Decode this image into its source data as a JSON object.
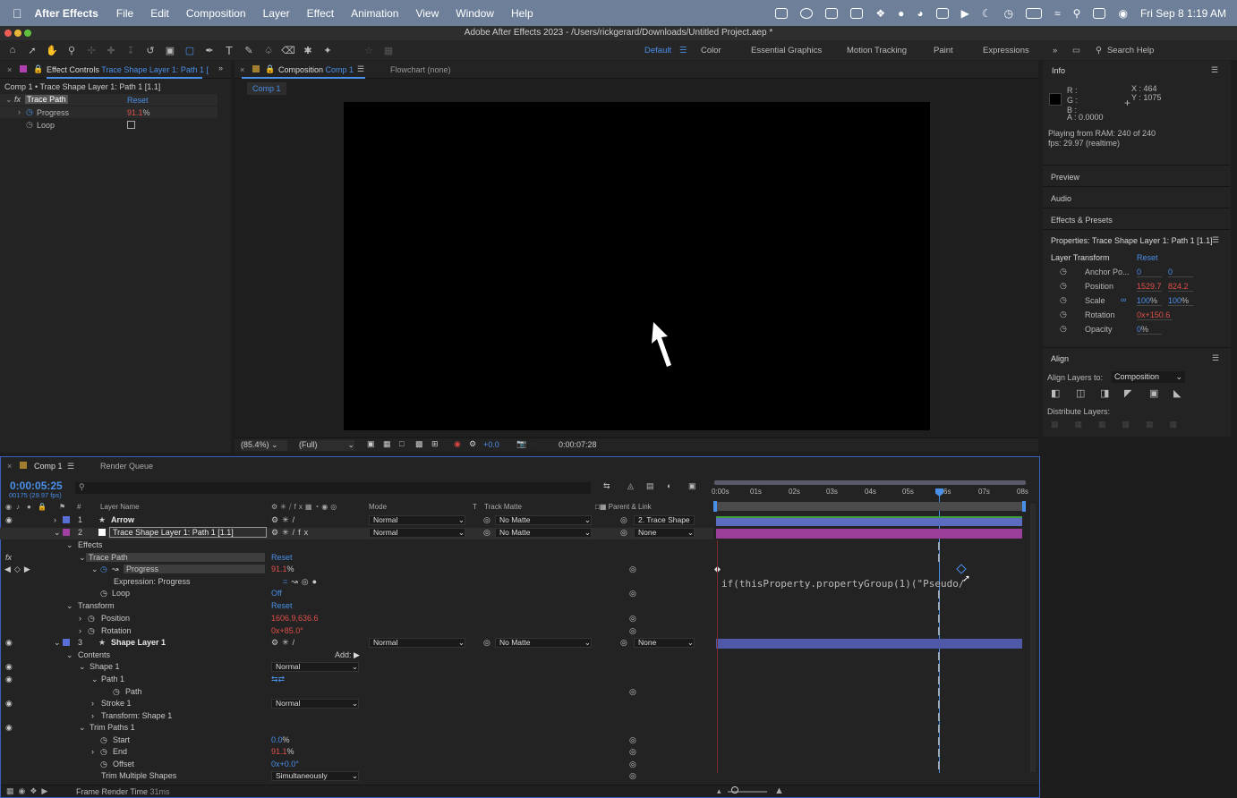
{
  "menubar": {
    "app": "After Effects",
    "items": [
      "File",
      "Edit",
      "Composition",
      "Layer",
      "Effect",
      "Animation",
      "View",
      "Window",
      "Help"
    ],
    "clock": "Fri Sep 8  1:19 AM"
  },
  "window": {
    "title": "Adobe After Effects 2023 - /Users/rickgerard/Downloads/Untitled Project.aep *"
  },
  "workspaces": {
    "active": "Default",
    "items": [
      "Color",
      "Essential Graphics",
      "Motion Tracking",
      "Paint",
      "Expressions"
    ],
    "search_placeholder": "Search Help"
  },
  "effect_controls": {
    "tab_label": "Effect Controls",
    "tab_layer": "Trace Shape Layer 1: Path 1 [",
    "breadcrumb": "Comp 1 • Trace Shape Layer 1: Path 1 [1.1]",
    "fx_name": "Trace Path",
    "reset": "Reset",
    "progress_label": "Progress",
    "progress_value": "91.1",
    "percent": "%",
    "loop_label": "Loop"
  },
  "composition": {
    "tab_label": "Composition",
    "tab_comp": "Comp 1",
    "flowchart": "Flowchart (none)",
    "subtab": "Comp 1",
    "zoom": "(85.4%)",
    "resolution": "(Full)",
    "exposure": "+0.0",
    "timecode": "0:00:07:28"
  },
  "info": {
    "title": "Info",
    "r": "R :",
    "g": "G :",
    "b": "B :",
    "a": "A :  0.0000",
    "x": "X : 464",
    "y": "Y : 1075",
    "playing": "Playing from RAM: 240 of 240",
    "fps": "fps: 29.97 (realtime)"
  },
  "sections": {
    "preview": "Preview",
    "audio": "Audio",
    "effects_presets": "Effects & Presets"
  },
  "properties": {
    "title": "Properties: Trace Shape Layer 1: Path 1 [1.1]",
    "group": "Layer Transform",
    "reset": "Reset",
    "anchor_label": "Anchor Po...",
    "anchor_x": "0",
    "anchor_y": "0",
    "position_label": "Position",
    "position_x": "1529.7",
    "position_y": "824.2",
    "scale_label": "Scale",
    "scale_x": "100",
    "scale_y": "100",
    "rotation_label": "Rotation",
    "rotation_value": "0x+150.6",
    "opacity_label": "Opacity",
    "opacity_value": "0"
  },
  "align": {
    "title": "Align",
    "align_to_label": "Align Layers to:",
    "align_to_value": "Composition",
    "distribute_label": "Distribute Layers:"
  },
  "timeline": {
    "tab": "Comp 1",
    "render_queue": "Render Queue",
    "timecode": "0:00:05:25",
    "frames": "00175 (29.97 fps)",
    "col_layer_name": "Layer Name",
    "col_mode": "Mode",
    "col_t": "T",
    "col_track_matte": "Track Matte",
    "col_parent": "Parent & Link",
    "ruler": [
      "0:00s",
      "01s",
      "02s",
      "03s",
      "04s",
      "05s",
      "6s",
      "07s",
      "08s"
    ],
    "layer1": {
      "num": "1",
      "name": "Arrow",
      "mode": "Normal",
      "matte": "No Matte",
      "parent": "2. Trace Shape"
    },
    "layer2": {
      "num": "2",
      "name": "Trace Shape Layer 1: Path 1 [1.1]",
      "mode": "Normal",
      "matte": "No Matte",
      "parent": "None"
    },
    "effects": "Effects",
    "trace_path": "Trace Path",
    "reset": "Reset",
    "progress": "Progress",
    "progress_value": "91.1",
    "percent": "%",
    "expression_label": "Expression: Progress",
    "expression_text": "if(thisProperty.propertyGroup(1)(\"Pseudo/",
    "loop": "Loop",
    "loop_value": "Off",
    "transform": "Transform",
    "transform_reset": "Reset",
    "position": "Position",
    "position_value": "1606.9,636.6",
    "rotation": "Rotation",
    "rotation_value": "0x+85.0°",
    "layer3": {
      "num": "3",
      "name": "Shape Layer 1",
      "mode": "Normal",
      "matte": "No Matte",
      "parent": "None"
    },
    "contents": "Contents",
    "add": "Add:",
    "shape1": "Shape 1",
    "shape1_mode": "Normal",
    "path1": "Path 1",
    "path": "Path",
    "stroke1": "Stroke 1",
    "stroke1_mode": "Normal",
    "transform_shape1": "Transform: Shape 1",
    "trim_paths": "Trim Paths 1",
    "start": "Start",
    "start_value": "0.0",
    "end": "End",
    "end_value": "91.1",
    "offset": "Offset",
    "offset_value": "0x+0.0°",
    "trim_multiple": "Trim Multiple Shapes",
    "trim_multiple_value": "Simultaneously",
    "frame_render": "Frame Render Time",
    "frame_render_value": "31ms"
  }
}
